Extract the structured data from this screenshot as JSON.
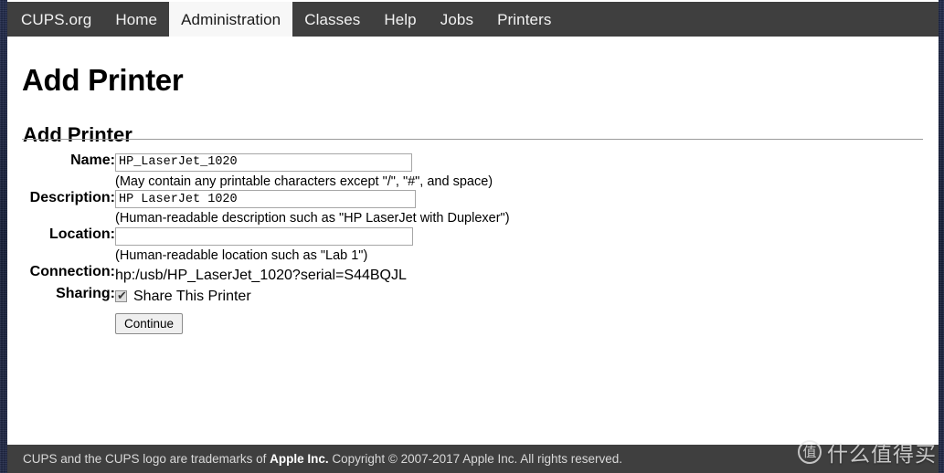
{
  "nav": {
    "items": [
      {
        "label": "CUPS.org",
        "active": false
      },
      {
        "label": "Home",
        "active": false
      },
      {
        "label": "Administration",
        "active": true
      },
      {
        "label": "Classes",
        "active": false
      },
      {
        "label": "Help",
        "active": false
      },
      {
        "label": "Jobs",
        "active": false
      },
      {
        "label": "Printers",
        "active": false
      }
    ]
  },
  "page": {
    "title": "Add Printer",
    "section_title": "Add Printer"
  },
  "form": {
    "name": {
      "label": "Name:",
      "value": "HP_LaserJet_1020",
      "placeholder": "",
      "hint": "(May contain any printable characters except \"/\", \"#\", and space)"
    },
    "description": {
      "label": "Description:",
      "value": "HP LaserJet 1020",
      "placeholder": "",
      "hint": "(Human-readable description such as \"HP LaserJet with Duplexer\")"
    },
    "location": {
      "label": "Location:",
      "value": "",
      "placeholder": "",
      "hint": "(Human-readable location such as \"Lab 1\")"
    },
    "connection": {
      "label": "Connection:",
      "value": "hp:/usb/HP_LaserJet_1020?serial=S44BQJL"
    },
    "sharing": {
      "label": "Sharing:",
      "checkbox_label": "Share This Printer",
      "checked": true,
      "check_glyph": "✔"
    },
    "submit": {
      "label": "Continue"
    }
  },
  "footer": {
    "text_before": "CUPS and the CUPS logo are trademarks of ",
    "text_bold": "Apple Inc.",
    "text_after": " Copyright © 2007-2017 Apple Inc. All rights reserved."
  },
  "watermark": {
    "logo_glyph": "值",
    "text": "什么值得买"
  },
  "colors": {
    "navbar": "#3f3f3f",
    "navbar_active_bg": "#f7f7f7",
    "frame": "#1b2340",
    "footer": "#3f3f3f",
    "rule": "#9a9a9a"
  }
}
